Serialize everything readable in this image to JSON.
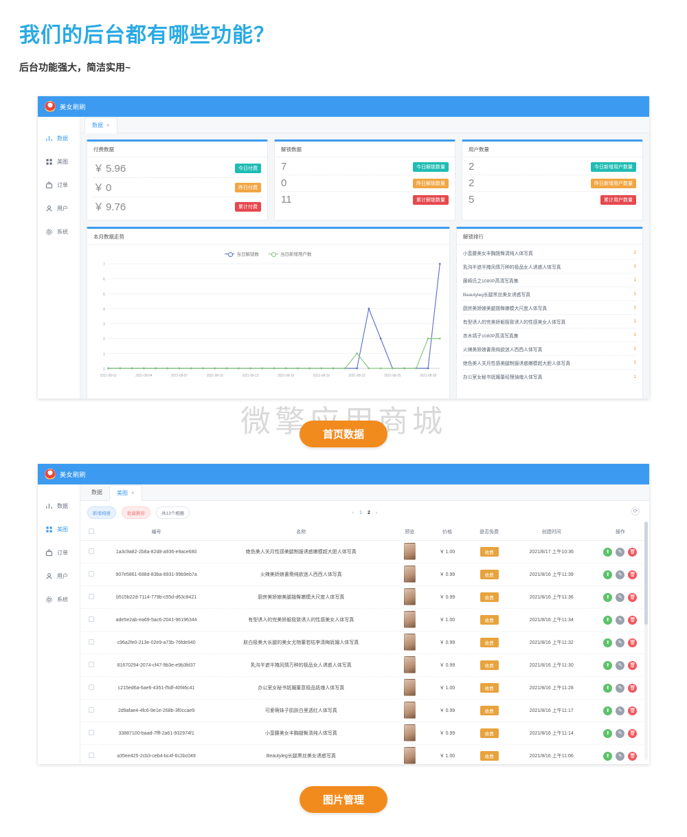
{
  "page": {
    "title": "我们的后台都有哪些功能？",
    "subtitle": "后台功能强大，简洁实用~",
    "watermark": "微擎应用商城",
    "caption1": "首页数据",
    "caption2": "图片管理",
    "title_color": "#29aae3",
    "accent_color": "#3c9bf0",
    "caption_color": "#f28b1e"
  },
  "app": {
    "brand": "美女刷刷",
    "sidebar": [
      {
        "label": "数据",
        "icon": "bar-chart-icon",
        "active": true
      },
      {
        "label": "美图",
        "icon": "grid-icon",
        "active": false
      },
      {
        "label": "订单",
        "icon": "bag-icon",
        "active": false
      },
      {
        "label": "用户",
        "icon": "user-icon",
        "active": false
      },
      {
        "label": "系统",
        "icon": "gear-icon",
        "active": false
      }
    ]
  },
  "dashboard": {
    "tabs": [
      {
        "label": "数据",
        "closable": true,
        "active": true
      }
    ],
    "cards": [
      {
        "title": "付费数据",
        "rows": [
          {
            "value": "5.96",
            "currency": "￥",
            "badge": "今日付费",
            "badge_color": "#1fbcb3"
          },
          {
            "value": "0",
            "currency": "￥",
            "badge": "昨日付费",
            "badge_color": "#f1a643"
          },
          {
            "value": "9.76",
            "currency": "￥",
            "badge": "累计付费",
            "badge_color": "#e5484d"
          }
        ]
      },
      {
        "title": "解锁数据",
        "rows": [
          {
            "value": "7",
            "currency": "",
            "badge": "今日解锁数量",
            "badge_color": "#1fbcb3"
          },
          {
            "value": "0",
            "currency": "",
            "badge": "昨日解锁数量",
            "badge_color": "#f1a643"
          },
          {
            "value": "11",
            "currency": "",
            "badge": "累计解锁数量",
            "badge_color": "#e5484d"
          }
        ]
      },
      {
        "title": "用户数量",
        "rows": [
          {
            "value": "2",
            "currency": "",
            "badge": "今日新增用户数量",
            "badge_color": "#1fbcb3"
          },
          {
            "value": "2",
            "currency": "",
            "badge": "昨日新增用户数量",
            "badge_color": "#f1a643"
          },
          {
            "value": "5",
            "currency": "",
            "badge": "累计用户数量",
            "badge_color": "#e5484d"
          }
        ]
      }
    ],
    "chart_panel_title": "本月数据走势",
    "rank_panel_title": "解锁排行",
    "ranking": [
      {
        "name": "小蛮腰美女丰胸翘臀清纯人体写真",
        "count": "2"
      },
      {
        "name": "乳沟半遮半掩风情万种的极品女人诱惑人体写真",
        "count": "1"
      },
      {
        "name": "藤崎氏之1080P高清写真集",
        "count": "1"
      },
      {
        "name": "Beautyleg长腿黑丝美女诱惑写真",
        "count": "1"
      },
      {
        "name": "厨房美娇娘美腿翘臀嫩模大尺度人体写真",
        "count": "1"
      },
      {
        "name": "有型诱人的完美娇躯极致诱人的性感美女人体写真",
        "count": "1"
      },
      {
        "name": "赤木靖子1080P高清写真集",
        "count": "1"
      },
      {
        "name": "火辣美娇娘書斋纯欲迷人西西人体写真",
        "count": "1"
      },
      {
        "name": "绝色美人关月性感美腿制服诱惑嫩模超大胆人体写真",
        "count": "1"
      },
      {
        "name": "办公室女秘书妩媚董经理骑魂人体写真",
        "count": "1"
      }
    ]
  },
  "chart_data": {
    "type": "line",
    "title": "本月数据走势",
    "xlabel": "",
    "ylabel": "",
    "grid": true,
    "legend_position": "top-center",
    "ylim": [
      0,
      7
    ],
    "yticks": [
      0,
      1,
      2,
      3,
      4,
      5,
      6,
      7
    ],
    "x": [
      "2021-08-01",
      "2021-08-02",
      "2021-08-03",
      "2021-08-04",
      "2021-08-05",
      "2021-08-06",
      "2021-08-07",
      "2021-08-08",
      "2021-08-09",
      "2021-08-10",
      "2021-08-11",
      "2021-08-12",
      "2021-08-13",
      "2021-08-14",
      "2021-08-15",
      "2021-08-16",
      "2021-08-17",
      "2021-08-18",
      "2021-08-19",
      "2021-08-20",
      "2021-08-21",
      "2021-08-22",
      "2021-08-23",
      "2021-08-24",
      "2021-08-25",
      "2021-08-26",
      "2021-08-27",
      "2021-08-28",
      "2021-08-29"
    ],
    "xtick_labels": [
      "2021-08-01",
      "2021-08-04",
      "2021-08-07",
      "2021-08-10",
      "2021-08-13",
      "2021-08-16",
      "2021-08-19",
      "2021-08-22",
      "2021-08-25",
      "2021-08-28"
    ],
    "series": [
      {
        "name": "当日解锁数",
        "color": "#5b6fc9",
        "values": [
          0,
          0,
          0,
          0,
          0,
          0,
          0,
          0,
          0,
          0,
          0,
          0,
          0,
          0,
          0,
          0,
          0,
          0,
          0,
          0,
          0,
          0,
          4,
          2,
          0,
          0,
          0,
          0,
          7
        ]
      },
      {
        "name": "当日新增用户数",
        "color": "#84c67a",
        "values": [
          0,
          0,
          0,
          0,
          0,
          0,
          0,
          0,
          0,
          0,
          0,
          0,
          0,
          0,
          0,
          0,
          0,
          0,
          0,
          0,
          0,
          1,
          0,
          0,
          0,
          0,
          0,
          2,
          2
        ]
      }
    ]
  },
  "gallery": {
    "tabs": [
      {
        "label": "数据",
        "closable": false,
        "active": false
      },
      {
        "label": "美图",
        "closable": true,
        "active": true
      }
    ],
    "toolbar": {
      "new_label": "新增相册",
      "delete_label": "批量删除",
      "count_label": "共13个相册",
      "refresh_icon": "refresh-icon"
    },
    "pager": {
      "prev": "‹",
      "pages": [
        "1",
        "2"
      ],
      "current": "2",
      "next": "›"
    },
    "columns": [
      "编号",
      "名称",
      "预览",
      "价格",
      "是否免费",
      "创建时间",
      "操作"
    ],
    "rows": [
      {
        "id": "1a3c9a82-2b8a-82d8-a936-e9ace680",
        "name": "绝色美人关月性感美腿制服诱惑嫩模超大胆人体写真",
        "price": "￥ 1.00",
        "free": "收费",
        "time": "2021/8/17 上午10:36"
      },
      {
        "id": "907e5861-698d-83ba-8931-99b9eb7a",
        "name": "火辣美娇娘書斋纯欲迷人西西人体写真",
        "price": "￥ 0.99",
        "free": "收费",
        "time": "2021/8/16 上午11:39"
      },
      {
        "id": "b515b22d-7114-779b-c55d-d63c8421",
        "name": "厨房美娇娘美腿翘臀嫩模大尺度人体写真",
        "price": "￥ 0.99",
        "free": "收费",
        "time": "2021/8/16 上午11:36"
      },
      {
        "id": "ade5e2ab-ea69-5ac6-2041-96196344",
        "name": "有型诱人的完美娇躯极致诱人的性感美女人体写真",
        "price": "￥ 1.00",
        "free": "收费",
        "time": "2021/8/16 上午11:34"
      },
      {
        "id": "c96a2fe0-213e-02e9-a73b-76fde940",
        "name": "肤白极美大长腿的美女尤物董若枯李清梅妩媚人体写真",
        "price": "￥ 0.99",
        "free": "收费",
        "time": "2021/8/16 上午11:32"
      },
      {
        "id": "81670294-2074-cf47-9b3e-e9b3fd37",
        "name": "乳沟半遮半掩风情万种的极品女人诱惑人体写真",
        "price": "￥ 0.99",
        "free": "收费",
        "time": "2021/8/16 上午11:30"
      },
      {
        "id": "c215ed6a-6ae6-4351-f5df-40f46c41",
        "name": "办公室女秘书妩媚董意极品妩魂人体写真",
        "price": "￥ 1.00",
        "free": "收费",
        "time": "2021/8/16 上午11:28"
      },
      {
        "id": "2d9afae4-4fc6-9e1e-268b-3f0ccae9",
        "name": "可爱萌妹子肌肤白里透红人体写真",
        "price": "￥ 0.99",
        "free": "收费",
        "time": "2021/8/16 上午11:17"
      },
      {
        "id": "33887100-baad-7fff-2a61-932974f1",
        "name": "小蛮腰美女丰胸翘臀清纯人体写真",
        "price": "￥ 0.99",
        "free": "收费",
        "time": "2021/8/16 上午11:14"
      },
      {
        "id": "a35ee425-2cb3-ceb4-bc4f-6c2bc049",
        "name": "Beautyleg长腿黑丝美女诱惑写真",
        "price": "￥ 1.00",
        "free": "收费",
        "time": "2021/8/16 上午11:06"
      }
    ],
    "ops": [
      {
        "icon": "upload-icon",
        "glyph": "⬆",
        "color": "#5ec269"
      },
      {
        "icon": "edit-icon",
        "glyph": "✎",
        "color": "#9aa2ad"
      },
      {
        "icon": "delete-icon",
        "glyph": "🗑",
        "color": "#f0585e"
      }
    ]
  }
}
